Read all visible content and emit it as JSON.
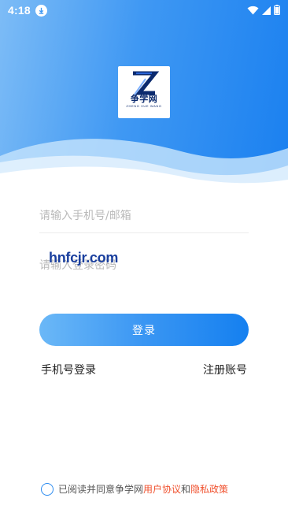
{
  "status_bar": {
    "time": "4:18",
    "icons": [
      "download-icon",
      "wifi-icon",
      "cell-signal-icon",
      "battery-icon"
    ]
  },
  "logo": {
    "mark": "Z",
    "name_cn": "争学网",
    "name_en": "ZHENG XUE WANG"
  },
  "form": {
    "account_placeholder": "请输入手机号/邮箱",
    "account_value": "",
    "password_placeholder": "请输入登录密码",
    "password_value": ""
  },
  "watermark": "hnfcjr.com",
  "login_label": "登录",
  "links": {
    "phone_login": "手机号登录",
    "register": "注册账号"
  },
  "agreement": {
    "checked": false,
    "prefix": "已阅读并同意争学网",
    "user_agreement": "用户协议",
    "and": "和",
    "privacy_policy": "隐私政策"
  },
  "colors": {
    "primary": "#1a80f0",
    "gradient_start": "#7dbcf6",
    "link_accent": "#f0502d",
    "placeholder": "#b9b9b9"
  }
}
